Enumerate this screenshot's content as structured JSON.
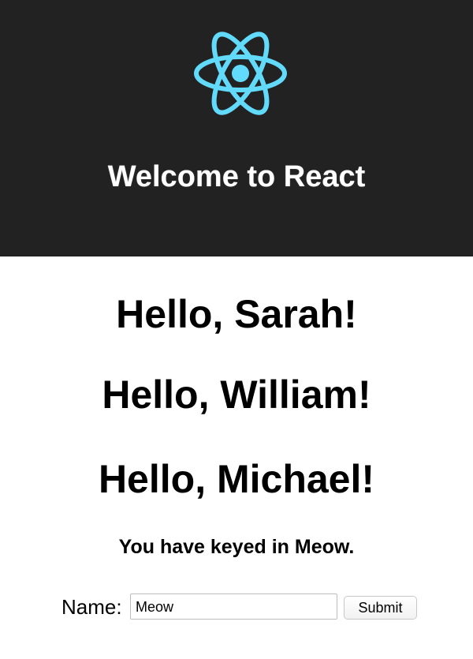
{
  "header": {
    "logo_icon": "react-atom-icon",
    "logo_color": "#61DAFB",
    "background_color": "#222222",
    "title": "Welcome to React"
  },
  "greetings": [
    "Hello, Sarah!",
    "Hello, William!",
    "Hello, Michael!"
  ],
  "keyed_text": "You have keyed in Meow.",
  "form": {
    "label": "Name:",
    "input_value": "Meow",
    "submit_label": "Submit"
  }
}
